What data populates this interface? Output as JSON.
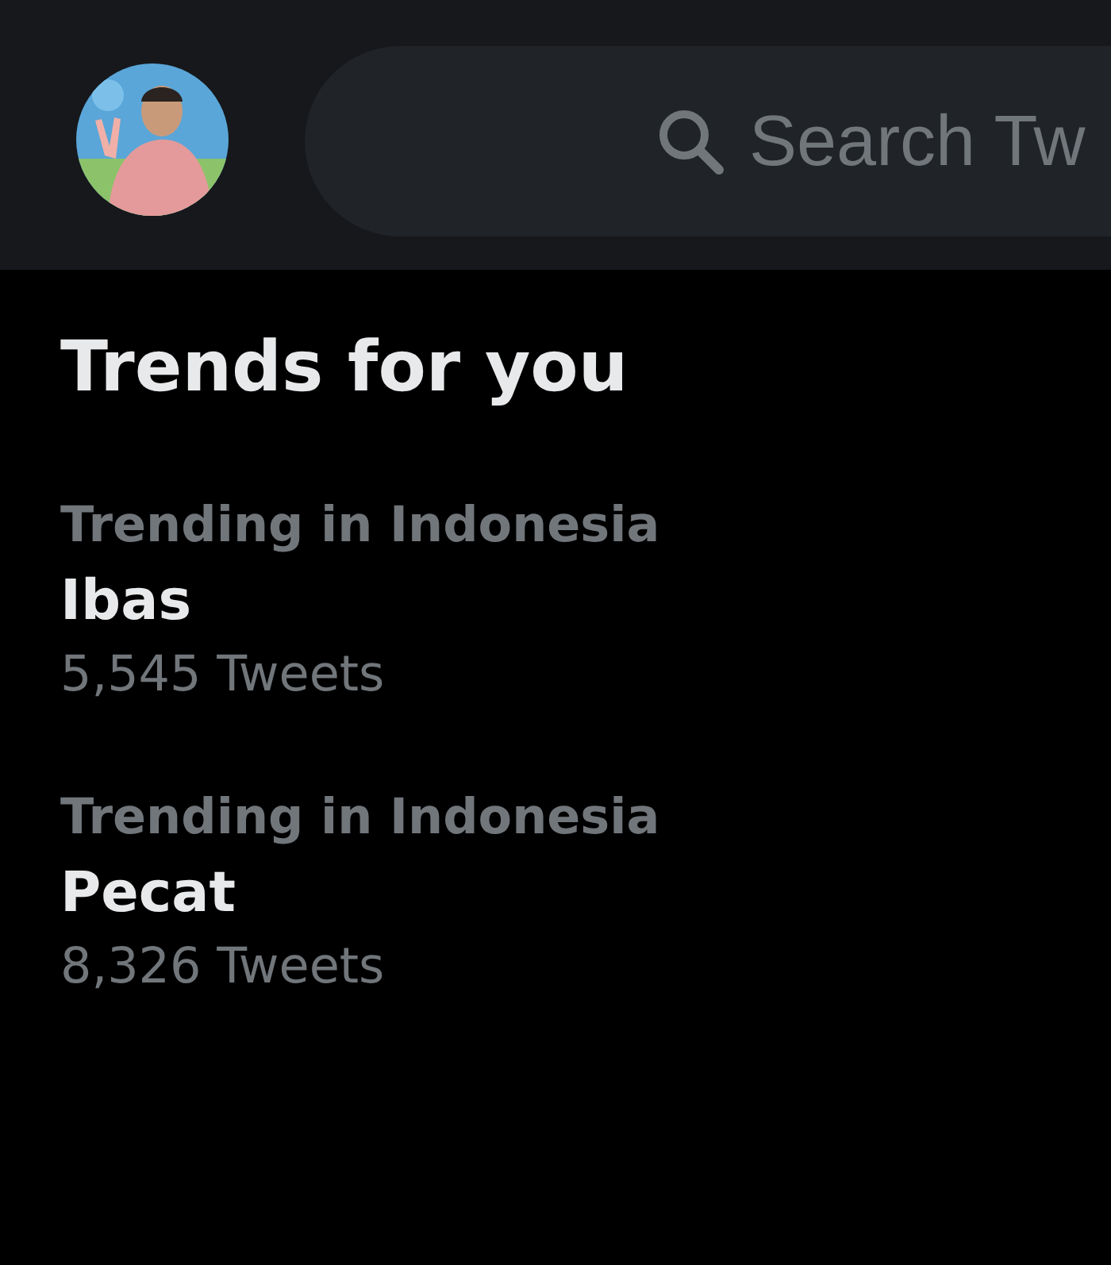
{
  "header": {
    "search": {
      "placeholder": "Search Tw"
    }
  },
  "section_title": "Trends for you",
  "trends": [
    {
      "category": "Trending in Indonesia",
      "name": "Ibas",
      "count": "5,545 Tweets"
    },
    {
      "category": "Trending in Indonesia",
      "name": "Pecat",
      "count": "8,326 Tweets"
    }
  ]
}
